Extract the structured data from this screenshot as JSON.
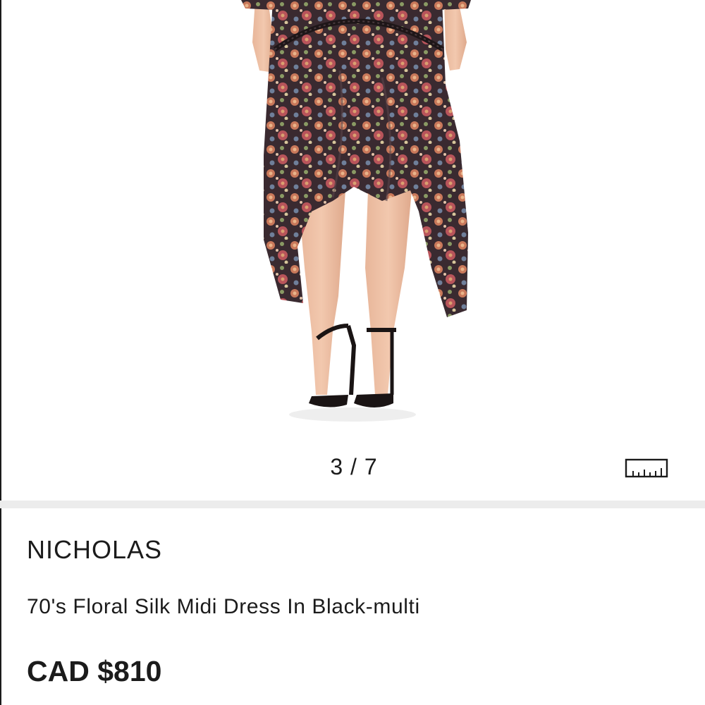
{
  "gallery": {
    "counter": "3 / 7",
    "size_guide_icon": "ruler-icon",
    "image_description_icon": "product-photo"
  },
  "product": {
    "brand": "NICHOLAS",
    "name": "70's Floral Silk Midi Dress In Black-multi",
    "price": "CAD $810"
  },
  "colors": {
    "text": "#1b1b1b",
    "divider": "#ececec",
    "background": "#ffffff"
  }
}
